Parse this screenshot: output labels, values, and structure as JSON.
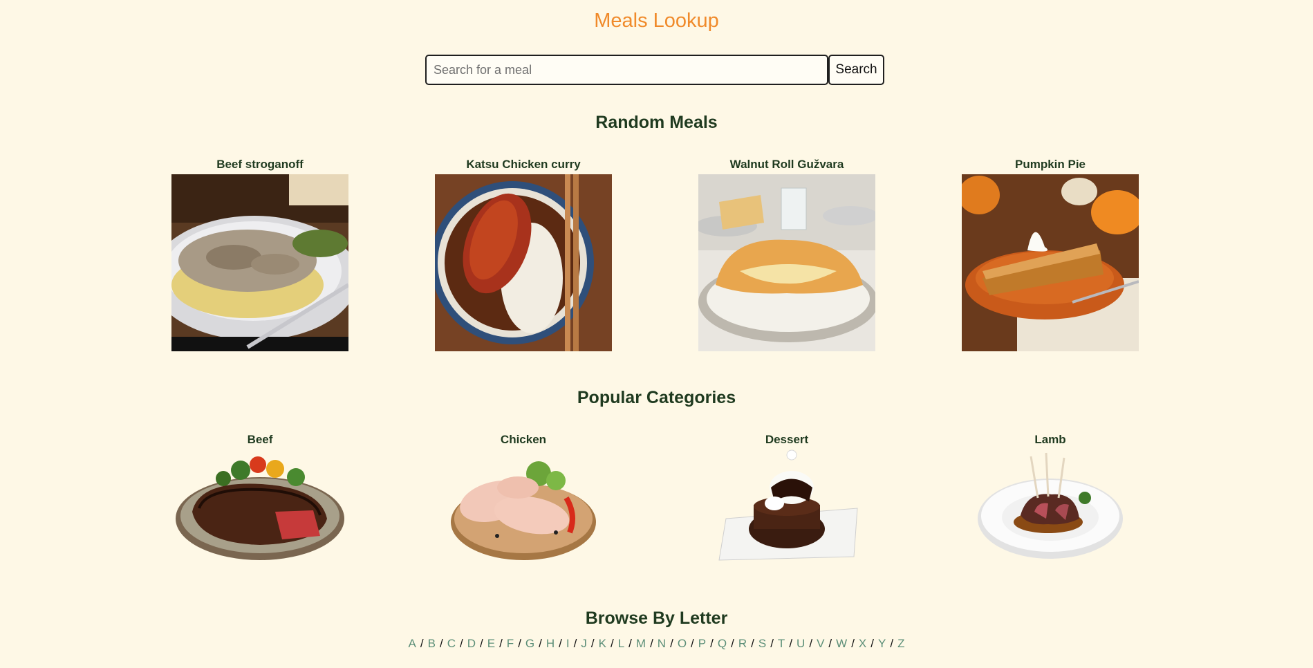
{
  "app": {
    "title": "Meals Lookup"
  },
  "search": {
    "placeholder": "Search for a meal",
    "value": "",
    "button_label": "Search"
  },
  "random_meals": {
    "heading": "Random Meals",
    "items": [
      {
        "name": "Beef stroganoff"
      },
      {
        "name": "Katsu Chicken curry"
      },
      {
        "name": "Walnut Roll Gužvara"
      },
      {
        "name": "Pumpkin Pie"
      }
    ]
  },
  "categories": {
    "heading": "Popular Categories",
    "items": [
      {
        "name": "Beef"
      },
      {
        "name": "Chicken"
      },
      {
        "name": "Dessert"
      },
      {
        "name": "Lamb"
      }
    ]
  },
  "browse": {
    "heading": "Browse By Letter",
    "letters": [
      "A",
      "B",
      "C",
      "D",
      "E",
      "F",
      "G",
      "H",
      "I",
      "J",
      "K",
      "L",
      "M",
      "N",
      "O",
      "P",
      "Q",
      "R",
      "S",
      "T",
      "U",
      "V",
      "W",
      "X",
      "Y",
      "Z"
    ],
    "separator": "/"
  },
  "colors": {
    "background": "#fef8e6",
    "title": "#f08a2a",
    "heading": "#1f3a1f",
    "letter_link": "#5c8f78"
  }
}
